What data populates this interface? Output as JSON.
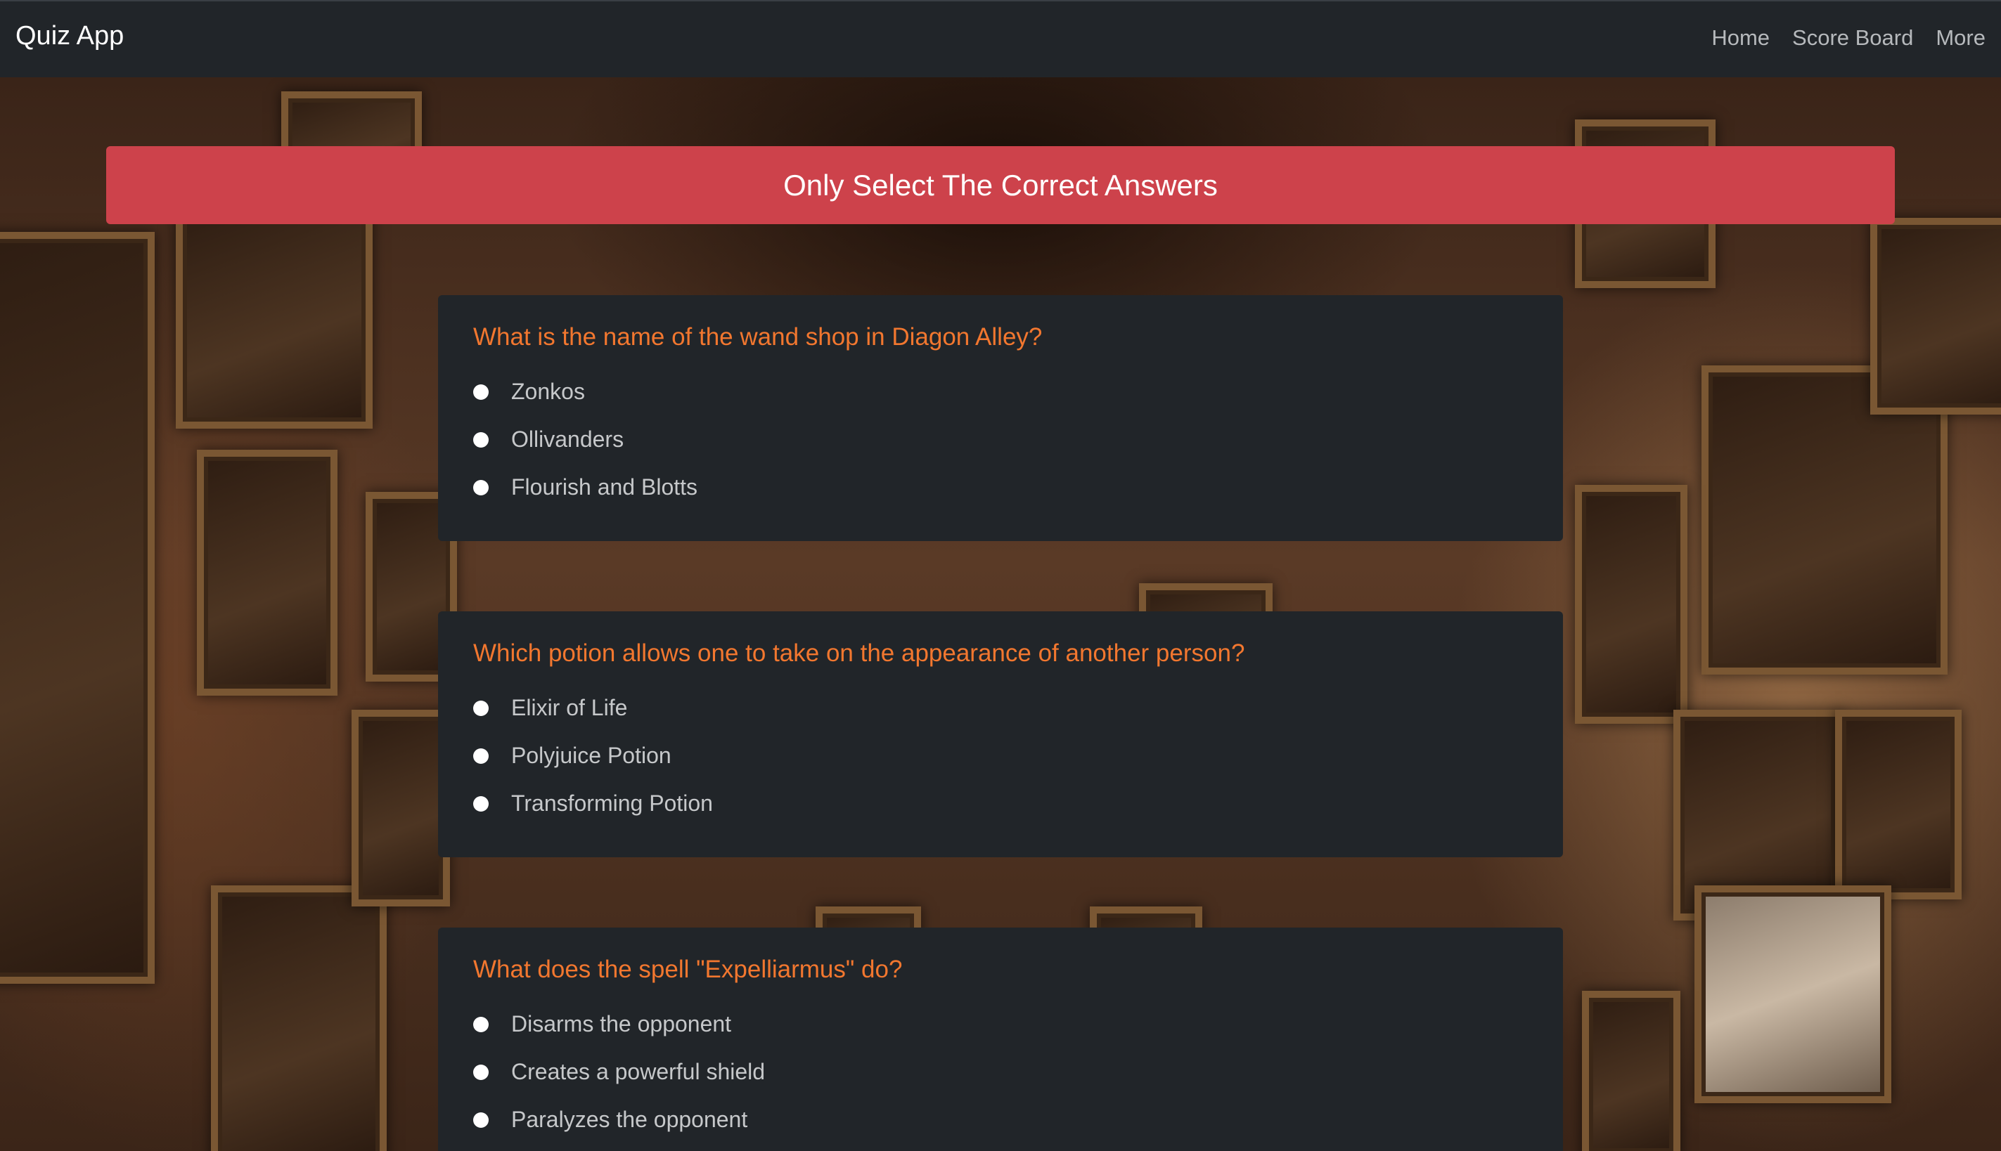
{
  "navbar": {
    "brand": "Quiz App",
    "links": [
      "Home",
      "Score Board",
      "More"
    ]
  },
  "banner": {
    "text": "Only Select The Correct Answers"
  },
  "questions": [
    {
      "text": "What is the name of the wand shop in Diagon Alley?",
      "options": [
        "Zonkos",
        "Ollivanders",
        "Flourish and Blotts"
      ]
    },
    {
      "text": "Which potion allows one to take on the appearance of another person?",
      "options": [
        "Elixir of Life",
        "Polyjuice Potion",
        "Transforming Potion"
      ]
    },
    {
      "text": "What does the spell \"Expelliarmus\" do?",
      "options": [
        "Disarms the opponent",
        "Creates a powerful shield",
        "Paralyzes the opponent"
      ]
    }
  ],
  "colors": {
    "navbar_bg": "#212529",
    "banner_bg": "#cd424b",
    "question_text": "#f2772f",
    "card_bg": "#212529"
  }
}
